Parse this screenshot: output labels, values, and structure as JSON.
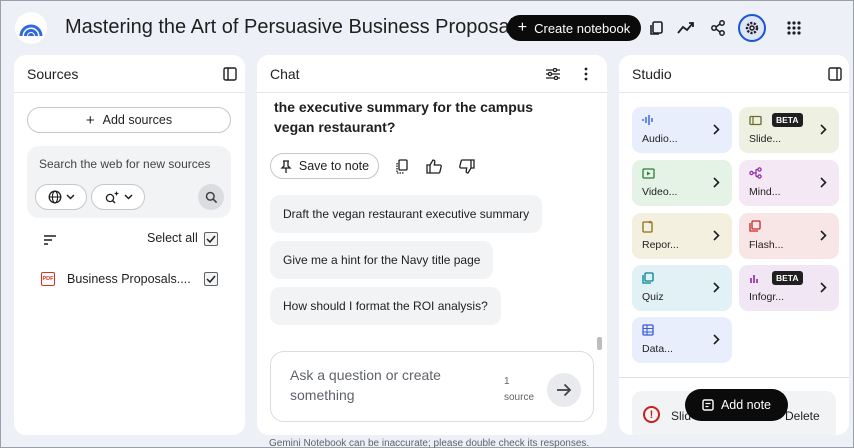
{
  "header": {
    "title": "Mastering the Art of Persuasive Business Proposals",
    "create_label": "Create notebook"
  },
  "sources": {
    "title": "Sources",
    "add_label": "Add sources",
    "search_placeholder": "Search the web for new sources",
    "select_all_label": "Select all",
    "items": [
      {
        "name": "Business Proposals....",
        "type": "PDF"
      }
    ]
  },
  "chat": {
    "title": "Chat",
    "question_lines": [
      "the executive summary for the campus",
      "vegan restaurant?"
    ],
    "save_label": "Save to note",
    "suggestions": [
      "Draft the vegan restaurant executive summary",
      "Give me a hint for the Navy title page",
      "How should I format the ROI analysis?"
    ],
    "input_placeholder": "Ask a question or create something",
    "source_count": "1",
    "source_word": "source",
    "disclaimer": "Gemini Notebook can be inaccurate; please double check its responses."
  },
  "studio": {
    "title": "Studio",
    "tiles": [
      {
        "label": "Audio...",
        "color": "#e8eefc",
        "icon": "audio-icon"
      },
      {
        "label": "Slide...",
        "color": "#eef0e2",
        "icon": "slides-icon",
        "badge": "BETA"
      },
      {
        "label": "Video...",
        "color": "#e4f3e6",
        "icon": "video-icon"
      },
      {
        "label": "Mind...",
        "color": "#f3e8f3",
        "icon": "mindmap-icon"
      },
      {
        "label": "Repor...",
        "color": "#f3f0e0",
        "icon": "report-icon"
      },
      {
        "label": "Flash...",
        "color": "#f8e6e6",
        "icon": "flashcards-icon"
      },
      {
        "label": "Quiz",
        "color": "#e1f1f6",
        "icon": "quiz-icon"
      },
      {
        "label": "Infogr...",
        "color": "#f1e6f3",
        "icon": "infographic-icon",
        "badge": "BETA"
      },
      {
        "label": "Data...",
        "color": "#e8eefc",
        "icon": "data-table-icon"
      }
    ],
    "note": {
      "text": "Slid",
      "delete_label": "Delete"
    },
    "add_note_label": "Add note"
  }
}
